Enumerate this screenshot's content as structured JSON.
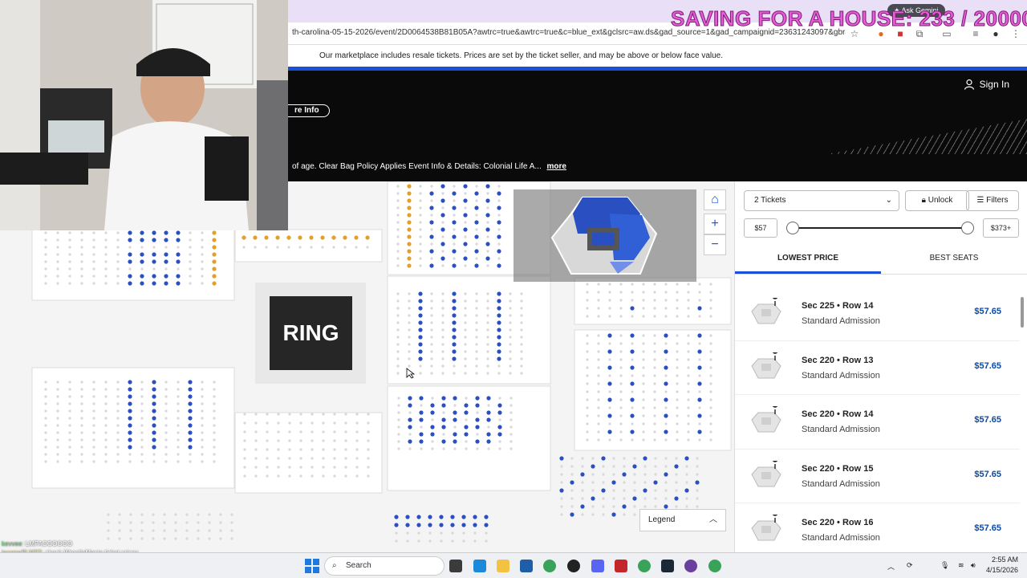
{
  "stream": {
    "overlay_text": "SAVING FOR A HOUSE: 233 / 20000",
    "chat": [
      {
        "user": "kevvee",
        "text": ": LMFAOOOOOO"
      },
      {
        "user": "jeromeSLM22",
        "text": ": check WrestleMania ticket prices"
      },
      {
        "user": "ccroyoko",
        "text": ":"
      }
    ]
  },
  "browser": {
    "url": "th-carolina-05-15-2026/event/2D0064538B81B05A?awtrc=true&awtrc=true&c=blue_ext&gclsrc=aw.ds&gad_source=1&gad_campaignid=23631243097&gbraid=0A...",
    "gemini_label": "Ask Gemini"
  },
  "notice": "Our marketplace includes resale tickets. Prices are set by the ticket seller, and may be above or below face value.",
  "header": {
    "sign_in": "Sign In",
    "more_info": "re Info",
    "event_desc": "of age. Clear Bag Policy Applies Event Info & Details: Colonial Life A...",
    "more_link": "more"
  },
  "map": {
    "ring_label": "RING",
    "legend_label": "Legend"
  },
  "filters": {
    "quantity": "2 Tickets",
    "unlock": "Unlock",
    "filters": "Filters",
    "price_min": "$57",
    "price_max": "$373+",
    "price_range_fraction": [
      0,
      1
    ]
  },
  "sort": {
    "lowest_price": "LOWEST PRICE",
    "best_seats": "BEST SEATS",
    "selected": "LOWEST PRICE"
  },
  "listings": [
    {
      "section": "Sec 225 • Row 14",
      "type": "Standard Admission",
      "price": "$57.65"
    },
    {
      "section": "Sec 220 • Row 13",
      "type": "Standard Admission",
      "price": "$57.65"
    },
    {
      "section": "Sec 220 • Row 14",
      "type": "Standard Admission",
      "price": "$57.65"
    },
    {
      "section": "Sec 220 • Row 15",
      "type": "Standard Admission",
      "price": "$57.65"
    },
    {
      "section": "Sec 220 • Row 16",
      "type": "Standard Admission",
      "price": "$57.65"
    }
  ],
  "taskbar": {
    "search": "Search",
    "time": "2:55 AM",
    "date": "4/15/2026"
  },
  "colors": {
    "accent_blue": "#1a4fd8",
    "price_blue": "#0b4aa8",
    "available_seat": "#2a4fc0",
    "unavailable_seat": "#d8d8d8",
    "gold_seat": "#e2a02a",
    "overlay_pink": "#e65cd7"
  }
}
